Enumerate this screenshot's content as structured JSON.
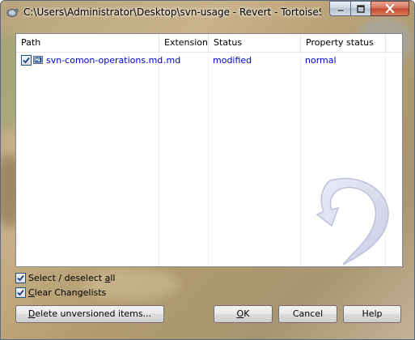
{
  "window": {
    "title": "C:\\Users\\Administrator\\Desktop\\svn-usage - Revert - TortoiseS..."
  },
  "caption_buttons": {
    "minimize_icon": "minimize-icon",
    "maximize_icon": "maximize-icon",
    "close_icon": "close-icon"
  },
  "list": {
    "columns": [
      "Path",
      "Extension",
      "Status",
      "Property status"
    ],
    "rows": [
      {
        "checked": true,
        "path": "svn-comon-operations.md",
        "extension": ".md",
        "status": "modified",
        "property_status": "normal"
      }
    ]
  },
  "options": {
    "select_all_pre": "Select / deselect ",
    "select_all_accel": "a",
    "select_all_post": "ll",
    "select_all_checked": true,
    "changelists_pre": "",
    "changelists_accel": "C",
    "changelists_post": "lear Changelists",
    "changelists_checked": true
  },
  "buttons": {
    "delete_accel": "D",
    "delete_rest": "elete unversioned items...",
    "ok_accel": "O",
    "ok_rest": "K",
    "cancel": "Cancel",
    "help": "Help"
  },
  "colors": {
    "item_text": "#0000cc"
  }
}
